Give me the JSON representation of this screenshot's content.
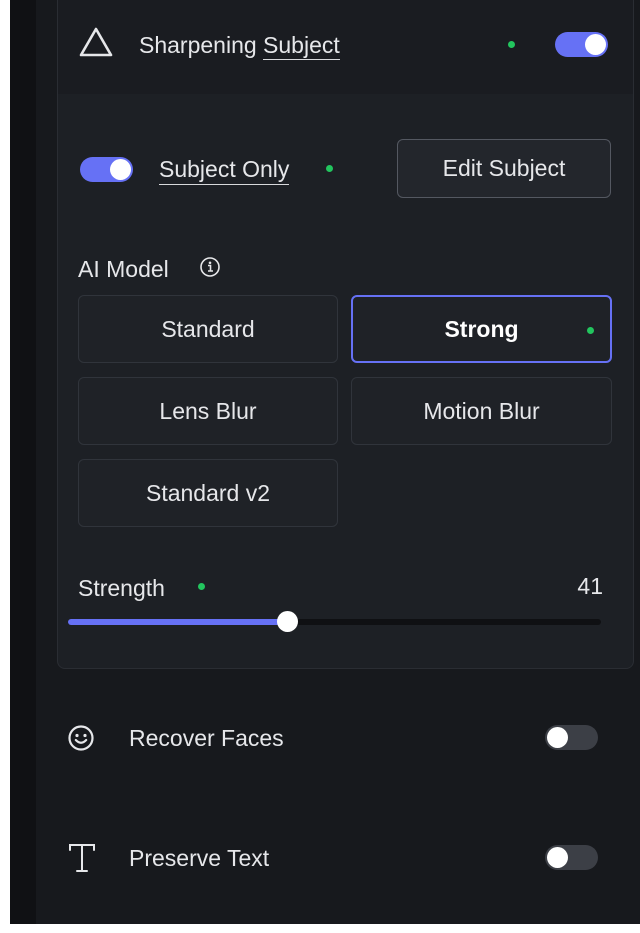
{
  "header": {
    "title_plain": "Sharpening",
    "title_underlined": "Subject",
    "enabled": true
  },
  "subject": {
    "toggle_on": true,
    "label": "Subject Only",
    "edit_button": "Edit Subject"
  },
  "ai_model": {
    "label": "AI Model",
    "info_icon": "info-circle-icon",
    "options": [
      "Standard",
      "Strong",
      "Lens Blur",
      "Motion Blur",
      "Standard v2"
    ],
    "selected": "Strong"
  },
  "strength": {
    "label": "Strength",
    "value": "41",
    "fraction": 0.41
  },
  "recover_faces": {
    "label": "Recover Faces",
    "icon": "smiley-face-icon",
    "toggle_on": false
  },
  "preserve_text": {
    "label": "Preserve Text",
    "icon": "text-t-icon",
    "toggle_on": false
  },
  "colors": {
    "accent": "#6671f5",
    "status_dot": "#22c55e",
    "background": "#17191d",
    "panel": "#1d2025"
  }
}
